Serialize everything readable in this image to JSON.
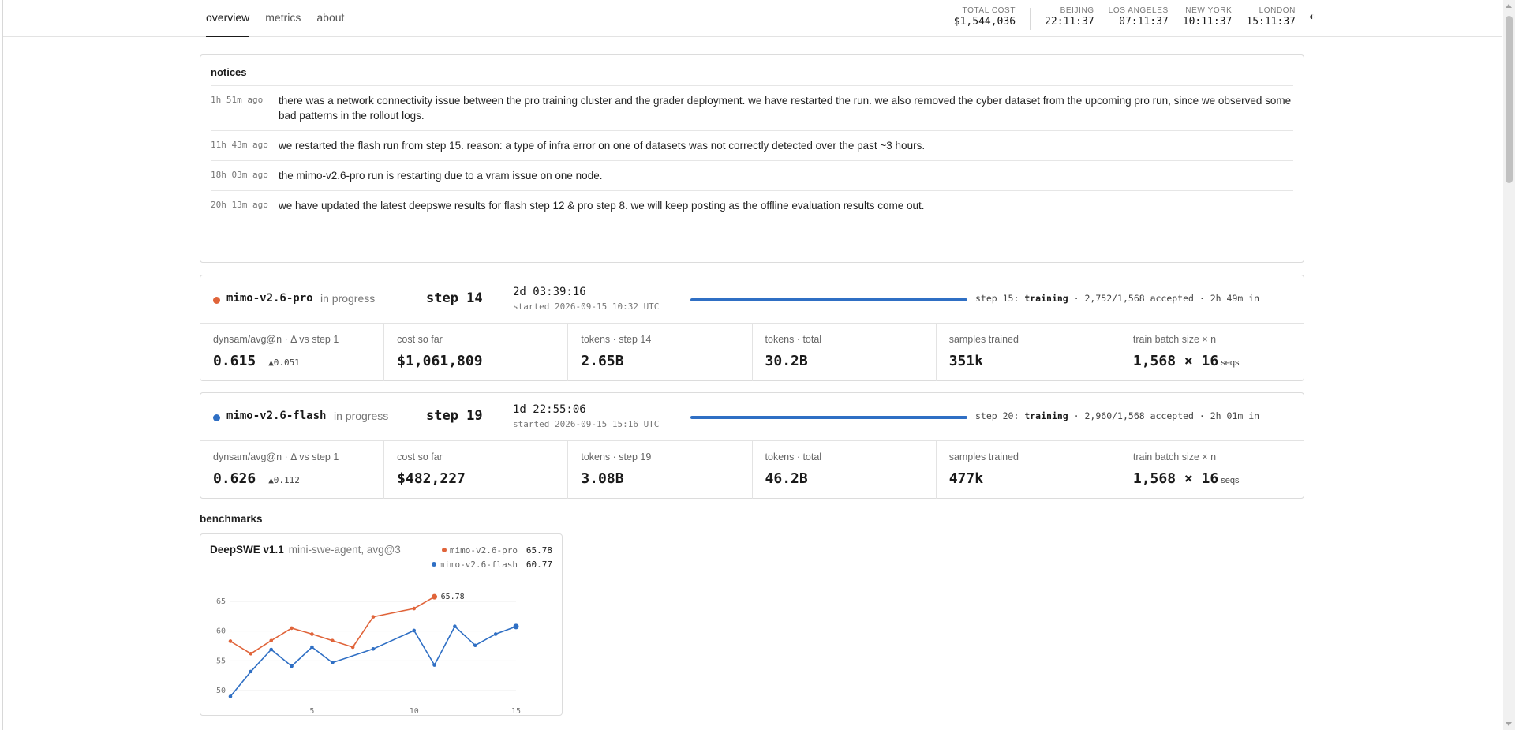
{
  "nav": {
    "tabs": [
      {
        "label": "overview",
        "active": true
      },
      {
        "label": "metrics",
        "active": false
      },
      {
        "label": "about",
        "active": false
      }
    ]
  },
  "header": {
    "total_cost_label": "TOTAL COST",
    "total_cost_value": "$1,544,036",
    "clocks": [
      {
        "label": "BEIJING",
        "time": "22:11:37"
      },
      {
        "label": "LOS ANGELES",
        "time": "07:11:37"
      },
      {
        "label": "NEW YORK",
        "time": "10:11:37"
      },
      {
        "label": "LONDON",
        "time": "15:11:37"
      }
    ],
    "theme_toggle": "◐"
  },
  "notices": {
    "title": "notices",
    "items": [
      {
        "ago": "1h 51m ago",
        "message": "there was a network connectivity issue between the pro training cluster and the grader deployment. we have restarted the run. we also removed the cyber dataset from the upcoming pro run, since we observed some bad patterns in the rollout logs."
      },
      {
        "ago": "11h 43m ago",
        "message": "we restarted the flash run from step 15. reason: a type of infra error on one of datasets was not correctly detected over the past ~3 hours."
      },
      {
        "ago": "18h 03m ago",
        "message": "the mimo-v2.6-pro run is restarting due to a vram issue on one node."
      },
      {
        "ago": "20h 13m ago",
        "message": "we have updated the latest deepswe results for flash step 12 & pro step 8. we will keep posting as the offline evaluation results come out."
      }
    ]
  },
  "runs": [
    {
      "color": "#e0643a",
      "name": "mimo-v2.6-pro",
      "status": "in progress",
      "step": "step 14",
      "elapsed": "2d 03:39:16",
      "started": "started 2026-09-15 10:32 UTC",
      "progress_prefix": "step 15:",
      "progress_phase": "training",
      "progress_suffix": "· 2,752/1,568 accepted · 2h 49m in",
      "metrics": [
        {
          "label": "dynsam/avg@n · Δ vs step 1",
          "value": "0.615",
          "delta": "▲0.051"
        },
        {
          "label": "cost so far",
          "value": "$1,061,809"
        },
        {
          "label": "tokens · step 14",
          "value": "2.65B"
        },
        {
          "label": "tokens · total",
          "value": "30.2B"
        },
        {
          "label": "samples trained",
          "value": "351k"
        },
        {
          "label": "train batch size × n",
          "value": "1,568 × 16",
          "unit": "seqs"
        }
      ]
    },
    {
      "color": "#2f6fc4",
      "name": "mimo-v2.6-flash",
      "status": "in progress",
      "step": "step 19",
      "elapsed": "1d 22:55:06",
      "started": "started 2026-09-15 15:16 UTC",
      "progress_prefix": "step 20:",
      "progress_phase": "training",
      "progress_suffix": "· 2,960/1,568 accepted · 2h 01m in",
      "metrics": [
        {
          "label": "dynsam/avg@n · Δ vs step 1",
          "value": "0.626",
          "delta": "▲0.112"
        },
        {
          "label": "cost so far",
          "value": "$482,227"
        },
        {
          "label": "tokens · step 19",
          "value": "3.08B"
        },
        {
          "label": "tokens · total",
          "value": "46.2B"
        },
        {
          "label": "samples trained",
          "value": "477k"
        },
        {
          "label": "train batch size × n",
          "value": "1,568 × 16",
          "unit": "seqs"
        }
      ]
    }
  ],
  "benchmarks": {
    "title": "benchmarks",
    "chart_title": "DeepSWE v1.1",
    "chart_subtitle": "mini-swe-agent, avg@3"
  },
  "chart_data": {
    "type": "line",
    "title": "DeepSWE v1.1",
    "subtitle": "mini-swe-agent, avg@3",
    "xlim": [
      1,
      15
    ],
    "ylim": [
      48,
      67
    ],
    "xticks": [
      5,
      10,
      15
    ],
    "yticks": [
      50,
      55,
      60,
      65
    ],
    "grid": true,
    "legend_position": "top-right",
    "series": [
      {
        "name": "mimo-v2.6-pro",
        "color": "#e0643a",
        "latest": "65.78",
        "x": [
          1,
          2,
          3,
          4,
          5,
          6,
          7,
          8,
          10,
          11
        ],
        "y": [
          58.3,
          56.2,
          58.4,
          60.5,
          59.5,
          58.4,
          57.3,
          62.4,
          63.8,
          65.78
        ]
      },
      {
        "name": "mimo-v2.6-flash",
        "color": "#2f6fc4",
        "latest": "60.77",
        "x": [
          1,
          2,
          3,
          4,
          5,
          6,
          8,
          10,
          11,
          12,
          13,
          14,
          15
        ],
        "y": [
          49.0,
          53.2,
          56.9,
          54.1,
          57.3,
          54.7,
          57.0,
          60.1,
          54.3,
          60.8,
          57.6,
          59.5,
          60.77
        ]
      }
    ],
    "annotations": [
      {
        "series": "mimo-v2.6-pro",
        "x": 11,
        "text": "65.78"
      }
    ]
  }
}
